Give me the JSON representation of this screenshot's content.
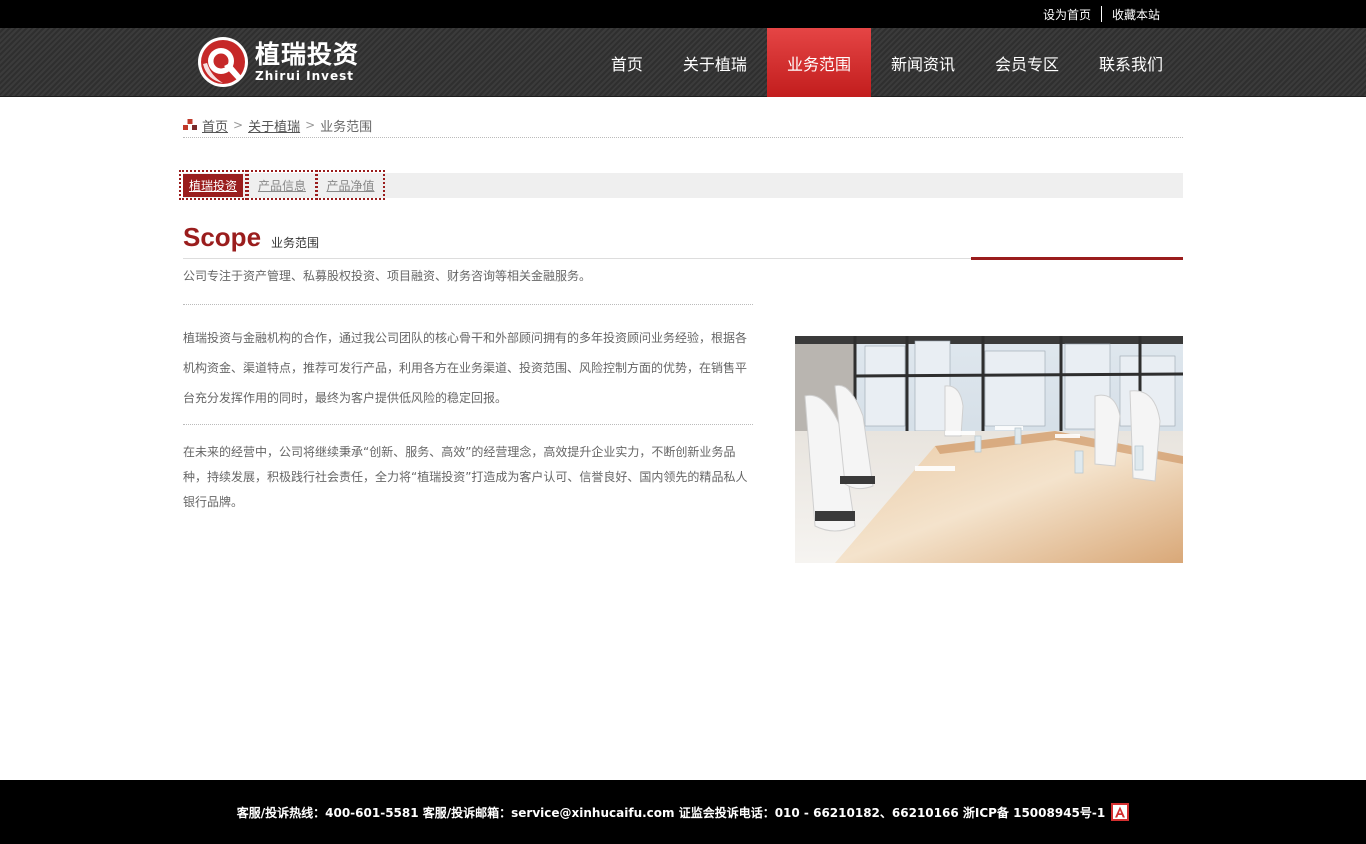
{
  "topbar": {
    "set_home": "设为首页",
    "bookmark": "收藏本站"
  },
  "brand": {
    "name_cn": "植瑞投资",
    "name_en": "Zhirui Invest",
    "color": "#c62828"
  },
  "nav": {
    "items": [
      {
        "label": "首页"
      },
      {
        "label": "关于植瑞"
      },
      {
        "label": "业务范围",
        "active": true
      },
      {
        "label": "新闻资讯"
      },
      {
        "label": "会员专区"
      },
      {
        "label": "联系我们"
      }
    ],
    "active_color": "#d32f2f"
  },
  "breadcrumb": {
    "home": "首页",
    "parent": "关于植瑞",
    "current": "业务范围",
    "separator": ">"
  },
  "subtabs": {
    "items": [
      {
        "label": "植瑞投资",
        "active": true
      },
      {
        "label": "产品信息"
      },
      {
        "label": "产品净值"
      }
    ]
  },
  "section": {
    "title_en": "Scope",
    "title_cn": "业务范围",
    "accent_color": "#9a1d1d"
  },
  "content": {
    "intro": "公司专注于资产管理、私募股权投资、项目融资、财务咨询等相关金融服务。",
    "paragraph1": "植瑞投资与金融机构的合作，通过我公司团队的核心骨干和外部顾问拥有的多年投资顾问业务经验，根据各机构资金、渠道特点，推荐可发行产品，利用各方在业务渠道、投资范围、风险控制方面的优势，在销售平台充分发挥作用的同时，最终为客户提供低风险的稳定回报。",
    "paragraph2": "在未来的经营中，公司将继续秉承“创新、服务、高效”的经营理念，高效提升企业实力，不断创新业务品种，持续发展，积极践行社会责任，全力将“植瑞投资”打造成为客户认可、信誉良好、国内领先的精品私人银行品牌。"
  },
  "footer": {
    "text": "客服/投诉热线：400-601-5581 客服/投诉邮箱：service@xinhucaifu.com 证监会投诉电话：010 - 66210182、66210166 浙ICP备 15008945号-1"
  }
}
